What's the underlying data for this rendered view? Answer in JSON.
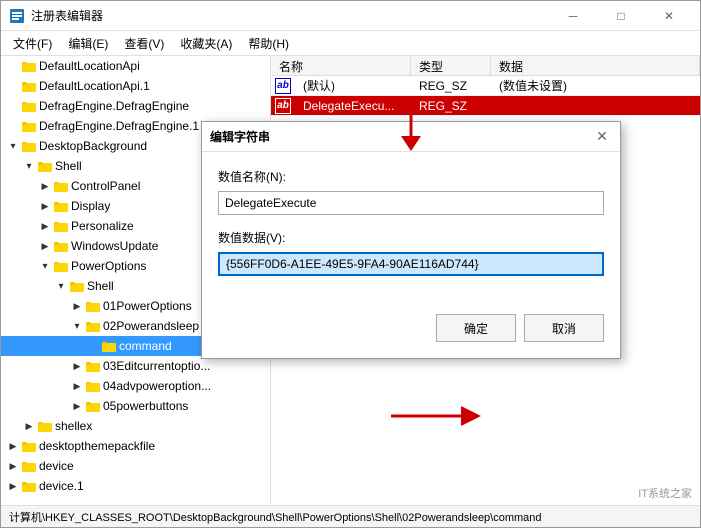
{
  "window": {
    "title": "注册表编辑器",
    "titleIcon": "💻",
    "minBtn": "─",
    "maxBtn": "□",
    "closeBtn": "✕"
  },
  "menuBar": {
    "items": [
      "文件(F)",
      "编辑(E)",
      "查看(V)",
      "收藏夹(A)",
      "帮助(H)"
    ]
  },
  "tree": {
    "items": [
      {
        "indent": 0,
        "expand": "",
        "label": "DefaultLocationApi",
        "level": 0
      },
      {
        "indent": 0,
        "expand": "",
        "label": "DefaultLocationApi.1",
        "level": 0
      },
      {
        "indent": 0,
        "expand": "",
        "label": "DefragEngine.DefragEngine",
        "level": 0
      },
      {
        "indent": 0,
        "expand": "",
        "label": "DefragEngine.DefragEngine.1",
        "level": 0
      },
      {
        "indent": 0,
        "expand": "▾",
        "label": "DesktopBackground",
        "level": 0,
        "expanded": true
      },
      {
        "indent": 1,
        "expand": "▾",
        "label": "Shell",
        "level": 1,
        "expanded": true,
        "selected": false
      },
      {
        "indent": 2,
        "expand": "▶",
        "label": "ControlPanel",
        "level": 2
      },
      {
        "indent": 2,
        "expand": "▶",
        "label": "Display",
        "level": 2
      },
      {
        "indent": 2,
        "expand": "▶",
        "label": "Personalize",
        "level": 2
      },
      {
        "indent": 2,
        "expand": "▶",
        "label": "WindowsUpdate",
        "level": 2
      },
      {
        "indent": 2,
        "expand": "▾",
        "label": "PowerOptions",
        "level": 2,
        "expanded": true
      },
      {
        "indent": 3,
        "expand": "▾",
        "label": "Shell",
        "level": 3,
        "expanded": true
      },
      {
        "indent": 4,
        "expand": "▶",
        "label": "01PowerOptions",
        "level": 4
      },
      {
        "indent": 4,
        "expand": "▾",
        "label": "02Powerandsleep",
        "level": 4,
        "expanded": true
      },
      {
        "indent": 5,
        "expand": "",
        "label": "command",
        "level": 5,
        "selected": true
      },
      {
        "indent": 4,
        "expand": "▶",
        "label": "03Editcurrentoptio...",
        "level": 4
      },
      {
        "indent": 4,
        "expand": "▶",
        "label": "04advpoweroption...",
        "level": 4
      },
      {
        "indent": 4,
        "expand": "▶",
        "label": "05powerbuttons",
        "level": 4
      },
      {
        "indent": 1,
        "expand": "▶",
        "label": "shellex",
        "level": 1
      },
      {
        "indent": 0,
        "expand": "▶",
        "label": "desktopthemepackfile",
        "level": 0
      },
      {
        "indent": 0,
        "expand": "▶",
        "label": "device",
        "level": 0
      },
      {
        "indent": 0,
        "expand": "▶",
        "label": "device.1",
        "level": 0
      }
    ]
  },
  "rightPanel": {
    "columns": [
      "名称",
      "类型",
      "数据"
    ],
    "rows": [
      {
        "name": "(默认)",
        "type": "REG_SZ",
        "data": "(数值未设置)",
        "highlighted": false
      },
      {
        "name": "DelegateExecu...",
        "type": "REG_SZ",
        "data": "",
        "highlighted": true
      }
    ]
  },
  "dialog": {
    "title": "编辑字符串",
    "closeBtn": "✕",
    "nameLabel": "数值名称(N):",
    "nameValue": "DelegateExecute",
    "dataLabel": "数值数据(V):",
    "dataValue": "{556FF0D6-A1EE-49E5-9FA4-90AE116AD744}",
    "okBtn": "确定",
    "cancelBtn": "取消"
  },
  "statusBar": {
    "text": "计算机\\HKEY_CLASSES_ROOT\\DesktopBackground\\Shell\\PowerOptions\\Shell\\02Powerandsleep\\command"
  }
}
